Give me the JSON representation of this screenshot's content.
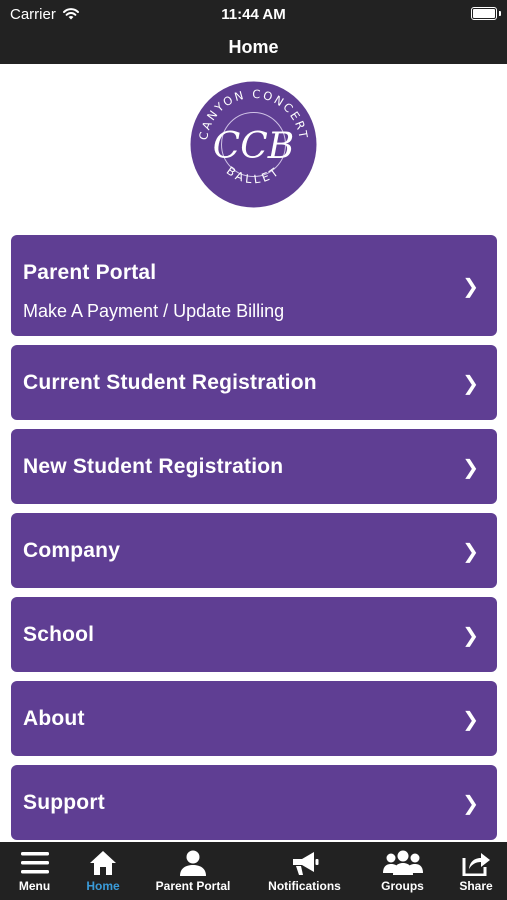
{
  "status_bar": {
    "carrier": "Carrier",
    "time": "11:44 AM"
  },
  "nav": {
    "title": "Home"
  },
  "logo": {
    "arc_top": "CANYON CONCERT",
    "monogram": "CCB",
    "arc_bottom": "BALLET",
    "color": "#5f3e93"
  },
  "menu": [
    {
      "title": "Parent Portal",
      "subtitle": "Make A Payment / Update Billing"
    },
    {
      "title": "Current Student Registration"
    },
    {
      "title": "New Student Registration"
    },
    {
      "title": "Company"
    },
    {
      "title": "School"
    },
    {
      "title": "About"
    },
    {
      "title": "Support"
    }
  ],
  "chevron": "❯",
  "tabs": [
    {
      "label": "Menu",
      "icon": "hamburger-icon"
    },
    {
      "label": "Home",
      "icon": "home-icon",
      "active": true
    },
    {
      "label": "Parent Portal",
      "icon": "person-icon"
    },
    {
      "label": "Notifications",
      "icon": "megaphone-icon"
    },
    {
      "label": "Groups",
      "icon": "group-icon"
    },
    {
      "label": "Share",
      "icon": "share-icon"
    }
  ],
  "colors": {
    "accent": "#5f3e93",
    "bar_bg": "#222222",
    "active_tab": "#3a9bd9"
  }
}
